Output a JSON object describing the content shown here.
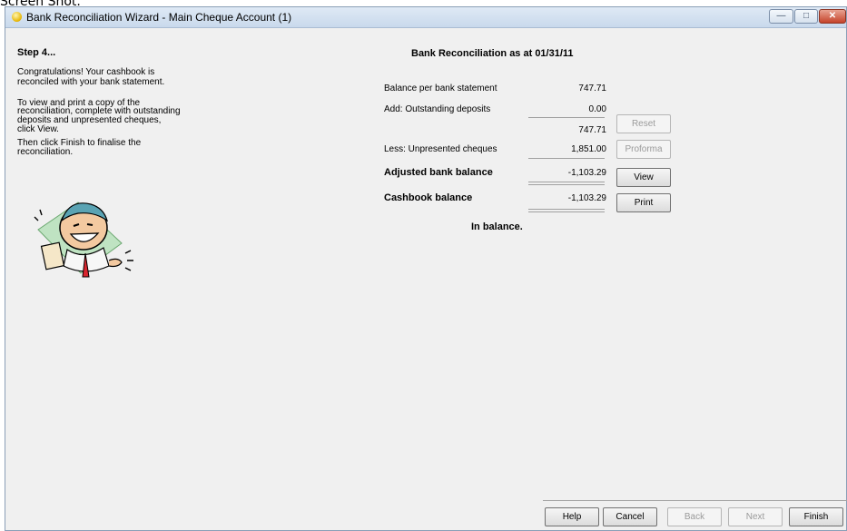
{
  "caption": "Screen Shot.",
  "window": {
    "title": "Bank Reconciliation Wizard - Main Cheque Account (1)",
    "icon": "bank-wizard-icon",
    "controls": [
      "minimize",
      "maximize",
      "close"
    ]
  },
  "left": {
    "step": "Step 4...",
    "para1_line1": "Congratulations! Your cashbook is",
    "para1_line2": "reconciled with your bank statement.",
    "para2_line1": "To view and print a copy of the",
    "para2_line2": "reconciliation, complete with outstanding",
    "para2_line3": "deposits and unpresented cheques,",
    "para2_line4": "click View.",
    "para3_line1": "Then click Finish to finalise the",
    "para3_line2": "reconciliation."
  },
  "summary": {
    "heading": "Bank Reconciliation as at 01/31/11",
    "rows": [
      {
        "label": "Balance per bank statement",
        "value": "747.71"
      },
      {
        "label": "Add: Outstanding deposits",
        "value": "0.00"
      },
      {
        "label": "",
        "value": "747.71"
      },
      {
        "label": "Less: Unpresented cheques",
        "value": "1,851.00"
      },
      {
        "label": "Adjusted bank balance",
        "value": "-1,103.29"
      },
      {
        "label": "Cashbook balance",
        "value": "-1,103.29"
      }
    ],
    "status": "In balance."
  },
  "side_buttons": {
    "reset": "Reset",
    "proforma": "Proforma",
    "view": "View",
    "print": "Print"
  },
  "footer": {
    "help": "Help",
    "cancel": "Cancel",
    "back": "Back",
    "next": "Next",
    "finish": "Finish"
  }
}
